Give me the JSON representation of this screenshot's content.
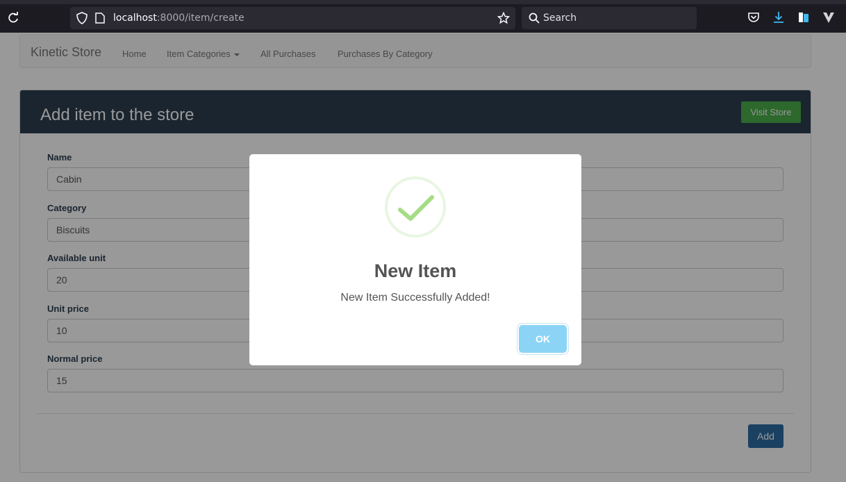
{
  "browser": {
    "url_host": "localhost",
    "url_path": ":8000/item/create",
    "search_placeholder": "Search"
  },
  "navbar": {
    "brand": "Kinetic Store",
    "items": [
      "Home",
      "Item Categories",
      "All Purchases",
      "Purchases By Category"
    ]
  },
  "panel": {
    "title": "Add item to the store",
    "visit_button": "Visit Store",
    "add_button": "Add"
  },
  "form": {
    "fields": [
      {
        "label": "Name",
        "value": "Cabin"
      },
      {
        "label": "Category",
        "value": "Biscuits"
      },
      {
        "label": "Available unit",
        "value": "20"
      },
      {
        "label": "Unit price",
        "value": "10"
      },
      {
        "label": "Normal price",
        "value": "15"
      }
    ]
  },
  "modal": {
    "icon": "success-check-icon",
    "title": "New Item",
    "text": "New Item Successfully Added!",
    "ok_button": "OK"
  },
  "colors": {
    "panel_header": "#2c3e50",
    "visit_button": "#4cae4c",
    "add_button": "#2e6da4",
    "ok_button": "#8cd4f5",
    "success_check": "#a5dc86"
  }
}
